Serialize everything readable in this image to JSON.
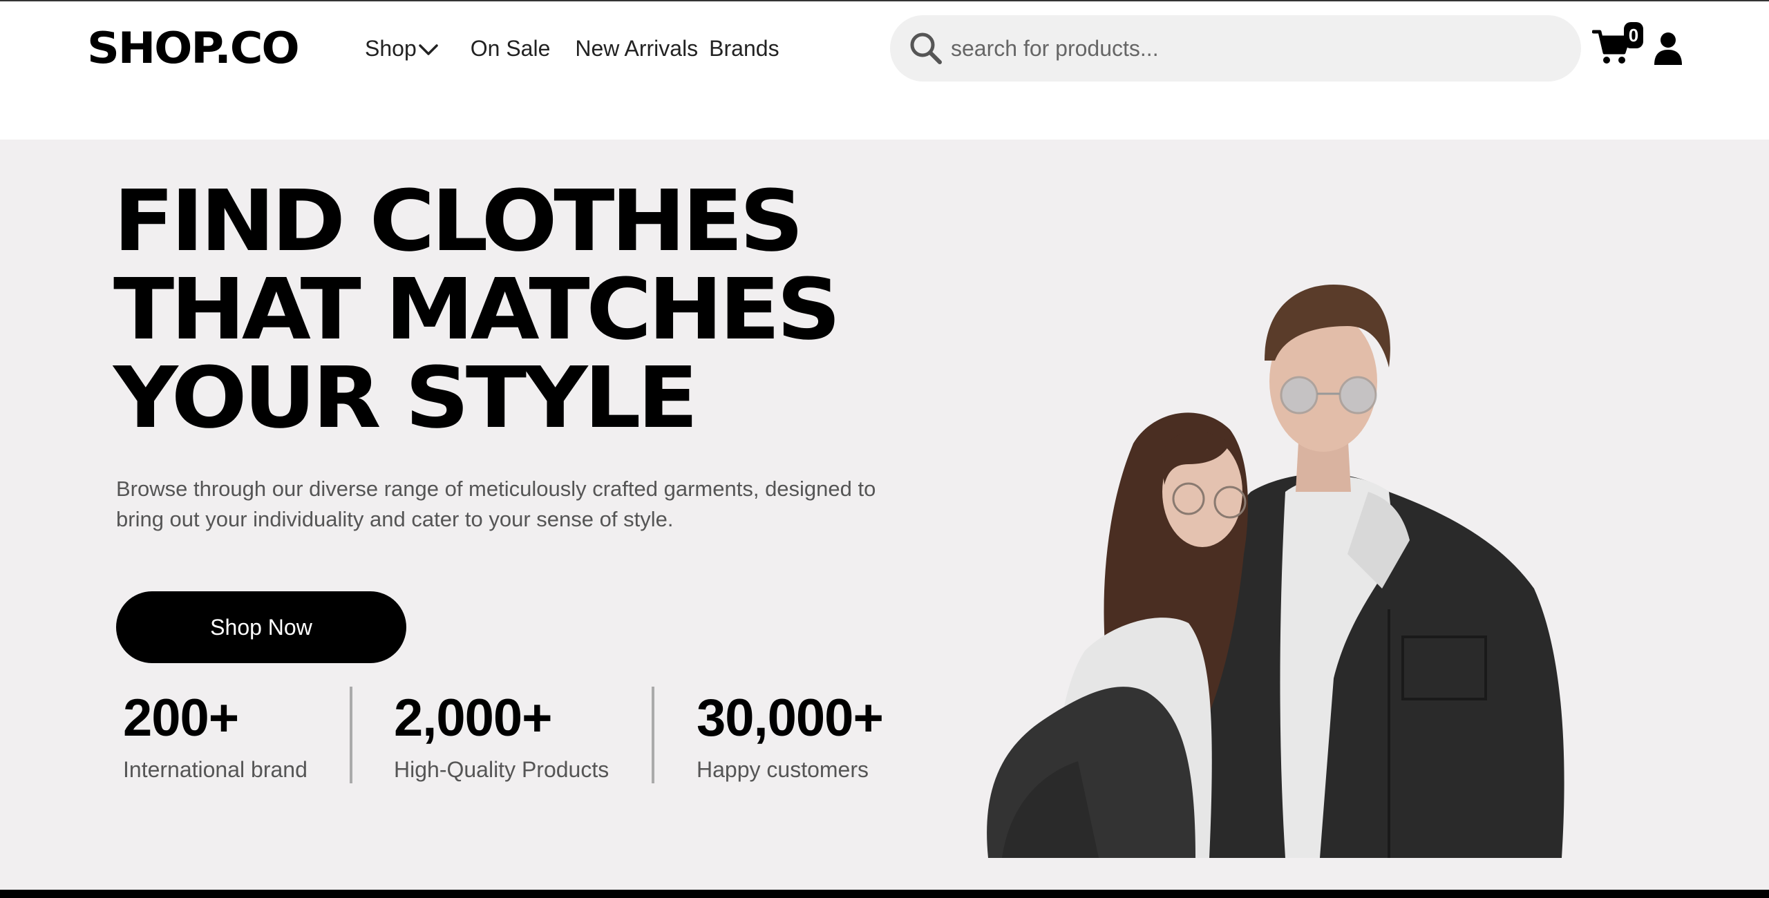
{
  "header": {
    "logo": "SHOP.CO",
    "nav": {
      "shop": "Shop",
      "on_sale": "On Sale",
      "new_arrivals": "New Arrivals",
      "brands": "Brands"
    },
    "search": {
      "placeholder": "search for products...",
      "value": ""
    },
    "cart": {
      "icon": "cart-icon",
      "count": "0"
    },
    "user": {
      "icon": "user-icon"
    }
  },
  "hero": {
    "title_lines": [
      "FIND CLOTHES",
      "THAT MATCHES",
      "YOUR STYLE"
    ],
    "description": "Browse through our diverse range of meticulously crafted garments, designed to bring out your individuality and cater to your sense of style.",
    "cta_label": "Shop Now",
    "stats": [
      {
        "value": "200+",
        "label": "International brand"
      },
      {
        "value": "2,000+",
        "label": "High-Quality Products"
      },
      {
        "value": "30,000+",
        "label": "Happy customers"
      }
    ],
    "image": "couple-photo"
  },
  "colors": {
    "hero_bg": "#f1eff0",
    "accent": "#000000",
    "search_bg": "#f0f0f0",
    "muted_text": "#555555"
  }
}
